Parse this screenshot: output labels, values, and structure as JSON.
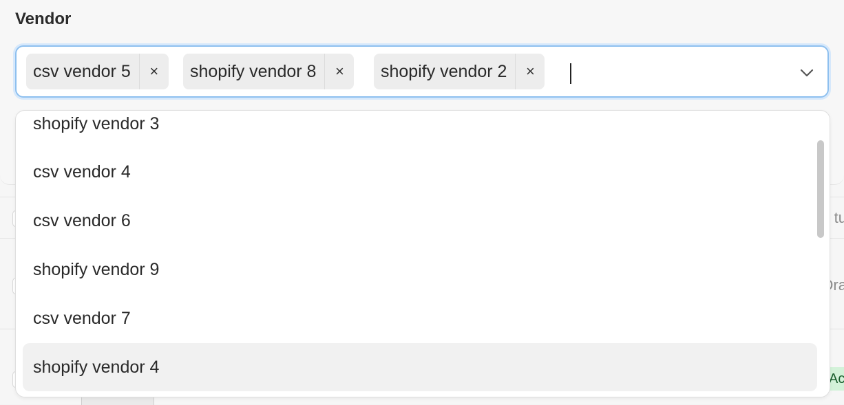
{
  "field": {
    "label": "Vendor",
    "selected": [
      {
        "label": "csv vendor 5",
        "remove": "×"
      },
      {
        "label": "shopify vendor 8",
        "remove": "×"
      },
      {
        "label": "shopify vendor 2",
        "remove": "×"
      }
    ],
    "expanded": true
  },
  "dropdown": {
    "options": [
      {
        "label": "shopify vendor 3"
      },
      {
        "label": "csv vendor 4"
      },
      {
        "label": "csv vendor 6"
      },
      {
        "label": "shopify vendor 9"
      },
      {
        "label": "csv vendor 7"
      },
      {
        "label": "shopify vendor 4",
        "highlighted": true
      }
    ]
  },
  "background": {
    "column_hint": "tu",
    "status_hint_1": "Dra",
    "status_hint_2": "Ac"
  },
  "colors": {
    "focus_border": "#8ec0ef",
    "chip_bg": "#ededed",
    "highlight_bg": "#f1f1f1",
    "active_badge_bg": "#d3f2d9"
  }
}
